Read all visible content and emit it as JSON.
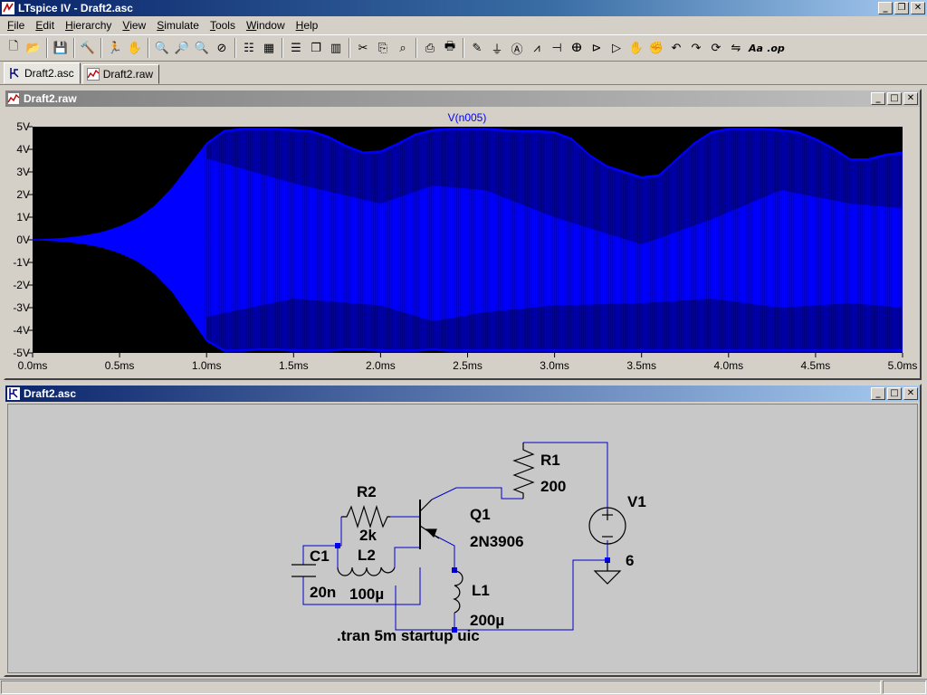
{
  "window": {
    "title": "LTspice IV - Draft2.asc"
  },
  "menu": [
    {
      "label": "File",
      "key": "F"
    },
    {
      "label": "Edit",
      "key": "E"
    },
    {
      "label": "Hierarchy",
      "key": "H"
    },
    {
      "label": "View",
      "key": "V"
    },
    {
      "label": "Simulate",
      "key": "S"
    },
    {
      "label": "Tools",
      "key": "T"
    },
    {
      "label": "Window",
      "key": "W"
    },
    {
      "label": "Help",
      "key": "H"
    }
  ],
  "toolbar": [
    "new-schematic-icon",
    "open-icon",
    "sep",
    "save-icon",
    "sep",
    "control-panel-icon",
    "sep",
    "run-icon",
    "halt-icon",
    "sep",
    "zoom-in-icon",
    "zoom-pan-icon",
    "zoom-out-icon",
    "zoom-cancel-icon",
    "sep",
    "autorange-icon",
    "grid-icon",
    "sep",
    "tile-horizontal-icon",
    "cascade-icon",
    "tile-vertical-icon",
    "sep",
    "cut-icon",
    "copy-icon",
    "find-icon",
    "sep",
    "print-preview-icon",
    "print-icon",
    "sep",
    "wire-icon",
    "ground-icon",
    "label-icon",
    "resistor-icon",
    "capacitor-icon",
    "inductor-icon",
    "diode-icon",
    "component-icon",
    "move-icon",
    "drag-icon",
    "undo-icon",
    "redo-icon",
    "rotate-icon",
    "mirror-icon",
    "text-icon",
    "spice-directive-icon"
  ],
  "tabs": [
    {
      "label": "Draft2.asc",
      "icon": "schematic-icon",
      "active": true
    },
    {
      "label": "Draft2.raw",
      "icon": "waveform-icon",
      "active": false
    }
  ],
  "plot_window": {
    "title": "Draft2.raw"
  },
  "schematic_window": {
    "title": "Draft2.asc"
  },
  "chart_data": {
    "type": "line",
    "title": "V(n005)",
    "xlabel": "",
    "ylabel": "",
    "xlim": [
      0,
      5
    ],
    "ylim": [
      -5,
      5
    ],
    "x_ticks": [
      "0.0ms",
      "0.5ms",
      "1.0ms",
      "1.5ms",
      "2.0ms",
      "2.5ms",
      "3.0ms",
      "3.5ms",
      "4.0ms",
      "4.5ms",
      "5.0ms"
    ],
    "y_ticks": [
      "5V",
      "4V",
      "3V",
      "2V",
      "1V",
      "0V",
      "-1V",
      "-2V",
      "-3V",
      "-4V",
      "-5V"
    ],
    "grid": false,
    "series": [
      {
        "name": "V(n005)",
        "color": "#0000ff",
        "envelope": {
          "t_ms": [
            0,
            0.1,
            0.2,
            0.3,
            0.4,
            0.5,
            0.6,
            0.7,
            0.8,
            0.9,
            1.0,
            1.1,
            1.2,
            1.3,
            1.4,
            1.5,
            1.6,
            1.7,
            1.8,
            1.9,
            2.0,
            2.1,
            2.2,
            2.3,
            2.4,
            2.5,
            2.6,
            2.7,
            2.8,
            2.9,
            3.0,
            3.1,
            3.2,
            3.3,
            3.4,
            3.5,
            3.6,
            3.7,
            3.8,
            3.9,
            4.0,
            4.1,
            4.2,
            4.3,
            4.4,
            4.5,
            4.6,
            4.7,
            4.8,
            4.9,
            5.0
          ],
          "upper_v": [
            0,
            0.05,
            0.1,
            0.2,
            0.35,
            0.6,
            0.95,
            1.5,
            2.3,
            3.3,
            4.3,
            4.85,
            4.95,
            4.95,
            4.95,
            4.9,
            4.85,
            4.6,
            4.2,
            3.9,
            3.95,
            4.3,
            4.7,
            4.9,
            4.95,
            4.95,
            4.95,
            4.9,
            4.85,
            4.85,
            4.8,
            4.5,
            3.8,
            3.3,
            3.05,
            2.8,
            2.9,
            3.6,
            4.3,
            4.8,
            4.95,
            4.95,
            4.95,
            4.9,
            4.8,
            4.5,
            4.1,
            3.6,
            3.6,
            3.8,
            3.9
          ],
          "lower_v": [
            0,
            -0.05,
            -0.1,
            -0.2,
            -0.35,
            -0.6,
            -0.95,
            -1.5,
            -2.3,
            -3.4,
            -4.5,
            -4.95,
            -4.95,
            -4.9,
            -4.9,
            -4.95,
            -4.95,
            -4.95,
            -4.9,
            -4.9,
            -4.95,
            -4.95,
            -4.95,
            -4.9,
            -4.95,
            -4.95,
            -4.95,
            -4.95,
            -4.95,
            -4.95,
            -4.95,
            -4.95,
            -4.95,
            -4.95,
            -4.95,
            -4.95,
            -4.95,
            -4.95,
            -4.95,
            -4.95,
            -4.95,
            -4.95,
            -4.95,
            -4.95,
            -4.95,
            -4.95,
            -4.95,
            -4.95,
            -4.95,
            -4.95,
            -4.95
          ]
        },
        "inner_dark_band_v": {
          "t_ms": [
            1.0,
            1.5,
            2.0,
            2.3,
            2.6,
            3.0,
            3.5,
            3.9,
            4.3,
            4.7,
            5.0
          ],
          "upper": [
            3.6,
            2.5,
            1.6,
            2.4,
            2.2,
            1.0,
            -0.2,
            0.9,
            2.2,
            1.6,
            1.4
          ],
          "lower": [
            -3.4,
            -2.6,
            -2.9,
            -3.6,
            -3.2,
            -2.9,
            -2.8,
            -2.6,
            -3.0,
            -2.8,
            -3.0
          ]
        }
      }
    ]
  },
  "schematic": {
    "components": [
      {
        "ref": "R1",
        "value": "200"
      },
      {
        "ref": "R2",
        "value": "2k"
      },
      {
        "ref": "C1",
        "value": "20n"
      },
      {
        "ref": "L2",
        "value": "100µ"
      },
      {
        "ref": "L1",
        "value": "200µ"
      },
      {
        "ref": "Q1",
        "value": "2N3906"
      },
      {
        "ref": "V1",
        "value": "6"
      }
    ],
    "directive": ".tran 5m startup uic",
    "wire_color": "#0000cc"
  }
}
